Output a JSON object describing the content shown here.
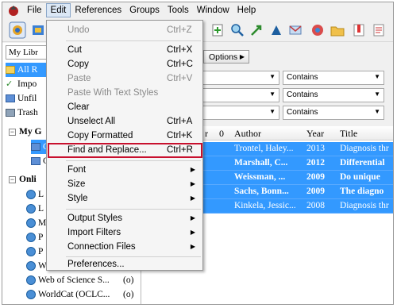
{
  "menubar": {
    "items": [
      "File",
      "Edit",
      "References",
      "Groups",
      "Tools",
      "Window",
      "Help"
    ]
  },
  "library_selector": "My Libr",
  "left_panel": {
    "items": [
      {
        "label": "All R"
      },
      {
        "label": "Impo"
      },
      {
        "label": "Unfil"
      },
      {
        "label": "Trash"
      }
    ],
    "my_groups_label": "My G",
    "group_items": [
      "C",
      "C"
    ],
    "online_label": "Onli",
    "online_items": [
      "L",
      "L",
      "M",
      "P",
      "P",
      "W"
    ],
    "online_full": [
      {
        "label": "Web of Science S...",
        "count": "(o)"
      },
      {
        "label": "WorldCat (OCLC...",
        "count": "(o)"
      }
    ]
  },
  "search": {
    "options_label": "Options",
    "rows": [
      {
        "operator": "Contains"
      },
      {
        "operator": "Contains"
      },
      {
        "operator": "Contains"
      }
    ]
  },
  "ref_list": {
    "columns": {
      "col1": "r",
      "attach": "0",
      "author": "Author",
      "year": "Year",
      "title": "Title"
    },
    "rows": [
      {
        "author": "Trontel, Haley...",
        "year": "2013",
        "title": "Diagnosis thr",
        "unread": false
      },
      {
        "author": "Marshall, C...",
        "year": "2012",
        "title": "Differential",
        "unread": true
      },
      {
        "author": "Weissman, ...",
        "year": "2009",
        "title": "Do unique",
        "unread": true
      },
      {
        "author": "Sachs, Bonn...",
        "year": "2009",
        "title": "The diagno",
        "unread": true
      },
      {
        "author": "Kinkela, Jessic...",
        "year": "2008",
        "title": "Diagnosis thr",
        "unread": false
      }
    ]
  },
  "edit_menu": {
    "items": [
      {
        "label": "Undo",
        "shortcut": "Ctrl+Z",
        "disabled": true
      },
      {
        "label": "Cut",
        "shortcut": "Ctrl+X",
        "disabled": false
      },
      {
        "label": "Copy",
        "shortcut": "Ctrl+C",
        "disabled": false
      },
      {
        "label": "Paste",
        "shortcut": "Ctrl+V",
        "disabled": true
      },
      {
        "label": "Paste With Text Styles",
        "shortcut": "",
        "disabled": true
      },
      {
        "label": "Clear",
        "shortcut": "",
        "disabled": false
      },
      {
        "label": "Unselect All",
        "shortcut": "Ctrl+A",
        "disabled": false
      },
      {
        "label": "Copy Formatted",
        "shortcut": "Ctrl+K",
        "disabled": false
      },
      {
        "label": "Find and Replace...",
        "shortcut": "Ctrl+R",
        "disabled": false
      },
      {
        "label": "Font",
        "shortcut": "",
        "disabled": false
      },
      {
        "label": "Size",
        "shortcut": "",
        "disabled": false
      },
      {
        "label": "Style",
        "shortcut": "",
        "disabled": false
      },
      {
        "label": "Output Styles",
        "shortcut": "",
        "disabled": false
      },
      {
        "label": "Import Filters",
        "shortcut": "",
        "disabled": false
      },
      {
        "label": "Connection Files",
        "shortcut": "",
        "disabled": false
      },
      {
        "label": "Preferences...",
        "shortcut": "",
        "disabled": false
      }
    ]
  },
  "colors": {
    "selection": "#3399ff",
    "highlight_box": "#c8102e"
  }
}
